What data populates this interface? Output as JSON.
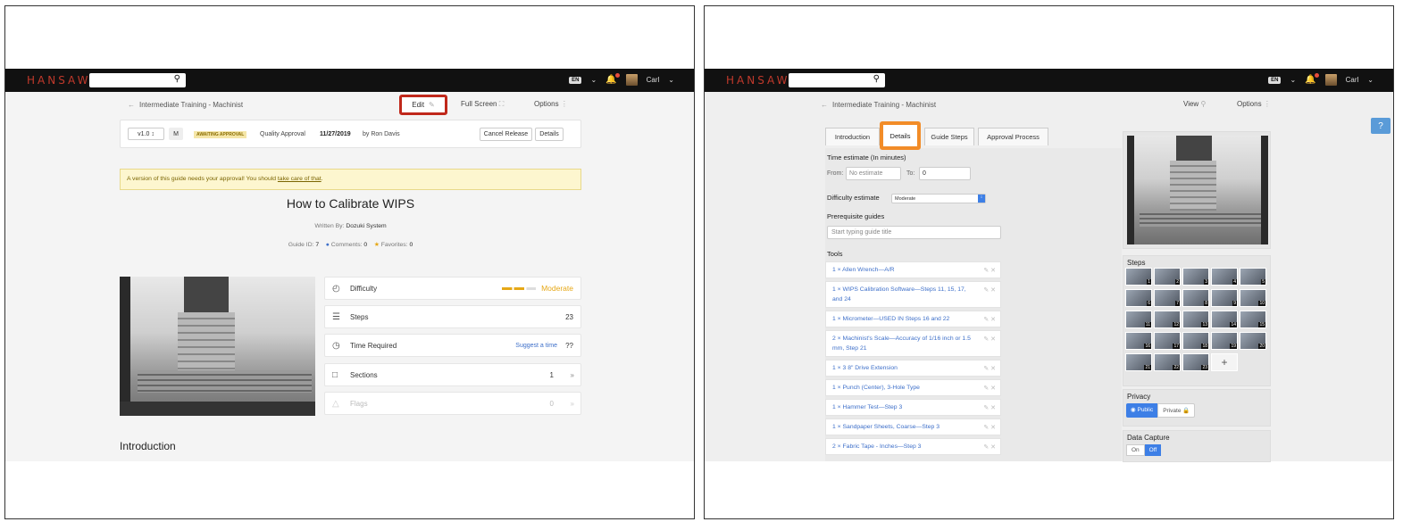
{
  "left": {
    "brand": "HANSAW",
    "lang": "EN",
    "user": "Carl",
    "breadcrumb": "Intermediate Training - Machinist",
    "edit": "Edit",
    "fullscreen": "Full Screen",
    "options": "Options",
    "version": "v1.0",
    "minor": "M",
    "badge": "AWAITING APPROVAL",
    "quality": "Quality Approval",
    "date": "11/27/2019",
    "by": "by Ron Davis",
    "cancel": "Cancel Release",
    "details": "Details",
    "notice_text": "A version of this guide needs your approval! You should ",
    "notice_link": "take care of that",
    "notice_end": ".",
    "title": "How to Calibrate WIPS",
    "written_label": "Written By:",
    "author": "Dozuki System",
    "guide_id_label": "Guide ID:",
    "guide_id": "7",
    "comments_label": "Comments:",
    "comments": "0",
    "favorites_label": "Favorites:",
    "favorites": "0",
    "rows": [
      {
        "label": "Difficulty",
        "value": "Moderate"
      },
      {
        "label": "Steps",
        "value": "23"
      },
      {
        "label": "Time Required",
        "link": "Suggest a time",
        "value": "??"
      },
      {
        "label": "Sections",
        "value": "1"
      },
      {
        "label": "Flags",
        "value": "0"
      }
    ],
    "intro": "Introduction",
    "highlight_color": "#c0281b",
    "difficulty_color": "#e6a817"
  },
  "right": {
    "brand": "HANSAW",
    "lang": "EN",
    "user": "Carl",
    "breadcrumb": "Intermediate Training - Machinist",
    "view": "View",
    "options": "Options",
    "help": "?",
    "tabs": [
      "Introduction",
      "Details",
      "Guide Steps",
      "Approval Process"
    ],
    "time_label": "Time estimate (In minutes)",
    "from": "From:",
    "from_placeholder": "No estimate",
    "to": "To:",
    "to_value": "0",
    "difficulty_label": "Difficulty estimate",
    "difficulty_value": "Moderate",
    "prereq_label": "Prerequisite guides",
    "prereq_placeholder": "Start typing guide title",
    "tools_label": "Tools",
    "tools": [
      "1 × Allen Wrench—A/R",
      "1 × WIPS Calibration Software—Steps 11, 15, 17, and 24",
      "1 × Micrometer—USED IN Steps 16 and 22",
      "2 × Machinist's Scale—Accuracy of 1/16 inch or 1.5 mm, Step 21",
      "1 × 3 8\" Drive Extension",
      "1 × Punch (Center), 3-Hole Type",
      "1 × Hammer Test—Step 3",
      "1 × Sandpaper Sheets, Coarse—Step 3",
      "2 × Fabric Tape - Inches—Step 3"
    ],
    "steps_label": "Steps",
    "step_numbers": [
      "1",
      "2",
      "3",
      "4",
      "5",
      "6",
      "7",
      "8",
      "9",
      "10",
      "11",
      "12",
      "13",
      "14",
      "15",
      "16",
      "17",
      "18",
      "19",
      "20",
      "21",
      "22",
      "23"
    ],
    "add": "+",
    "privacy_label": "Privacy",
    "public": "Public",
    "private": "Private",
    "capture_label": "Data Capture",
    "on": "On",
    "off": "Off",
    "highlight_color": "#f28c28"
  }
}
